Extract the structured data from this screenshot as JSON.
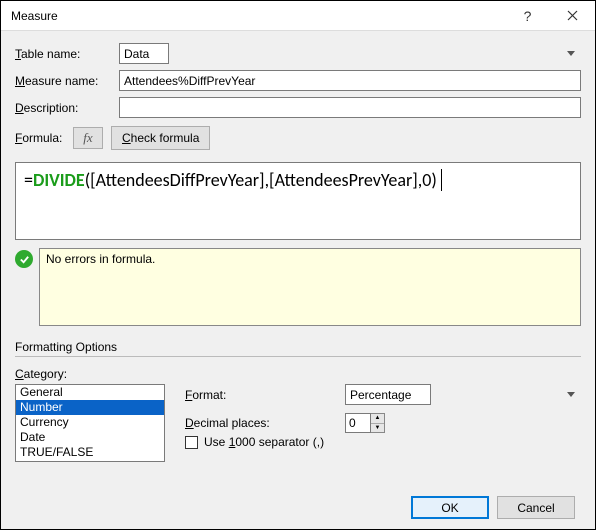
{
  "window": {
    "title": "Measure"
  },
  "labels": {
    "table_name": "Table name:",
    "measure_name": "Measure name:",
    "description": "Description:",
    "formula": "Formula:",
    "check_formula": "Check formula",
    "fx": "fx",
    "formatting_options": "Formatting Options",
    "category": "Category:",
    "format": "Format:",
    "decimal_places": "Decimal places:",
    "use_1000_sep": "Use 1000 separator (,)",
    "ok": "OK",
    "cancel": "Cancel"
  },
  "ul_chars": {
    "table_name": "T",
    "measure_name": "M",
    "description": "D",
    "formula": "F",
    "check_formula": "C",
    "category": "C",
    "format": "F",
    "decimal_places": "D",
    "use_1000_sep": "1"
  },
  "values": {
    "table_name": "Data",
    "measure_name": "Attendees%DiffPrevYear",
    "description": "",
    "formula_prefix": "=",
    "formula_fn": "DIVIDE",
    "formula_rest": "([AttendeesDiffPrevYear],[AttendeesPrevYear],0)",
    "status_msg": "No errors in formula.",
    "format": "Percentage",
    "decimal_places": "0",
    "use_1000_sep": false
  },
  "category_list": [
    "General",
    "Number",
    "Currency",
    "Date",
    "TRUE/FALSE"
  ],
  "category_selected": "Number"
}
